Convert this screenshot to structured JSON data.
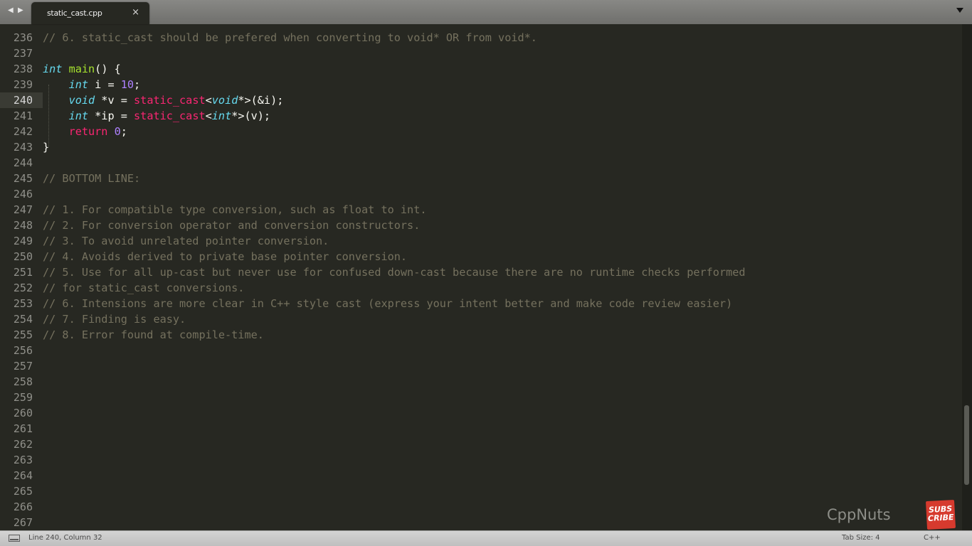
{
  "tab": {
    "nav_prev": "◀",
    "nav_next": "▶",
    "title": "static_cast.cpp",
    "close": "×"
  },
  "lines": [
    {
      "n": "236",
      "text": "// 6. static_cast should be prefered when converting to void* OR from void*."
    },
    {
      "n": "237",
      "text": ""
    },
    {
      "n": "238",
      "text": "int main() {"
    },
    {
      "n": "239",
      "text": "    int i = 10;"
    },
    {
      "n": "240",
      "text": "    void *v = static_cast<void*>(&i);"
    },
    {
      "n": "241",
      "text": "    int *ip = static_cast<int*>(v);"
    },
    {
      "n": "242",
      "text": "    return 0;"
    },
    {
      "n": "243",
      "text": "}"
    },
    {
      "n": "244",
      "text": ""
    },
    {
      "n": "245",
      "text": "// BOTTOM LINE:"
    },
    {
      "n": "246",
      "text": ""
    },
    {
      "n": "247",
      "text": "// 1. For compatible type conversion, such as float to int."
    },
    {
      "n": "248",
      "text": "// 2. For conversion operator and conversion constructors."
    },
    {
      "n": "249",
      "text": "// 3. To avoid unrelated pointer conversion."
    },
    {
      "n": "250",
      "text": "// 4. Avoids derived to private base pointer conversion."
    },
    {
      "n": "251",
      "text": "// 5. Use for all up-cast but never use for confused down-cast because there are no runtime checks performed"
    },
    {
      "n": "252",
      "text": "// for static_cast conversions."
    },
    {
      "n": "253",
      "text": "// 6. Intensions are more clear in C++ style cast (express your intent better and make code review easier)"
    },
    {
      "n": "254",
      "text": "// 7. Finding is easy."
    },
    {
      "n": "255",
      "text": "// 8. Error found at compile-time."
    },
    {
      "n": "256",
      "text": ""
    },
    {
      "n": "257",
      "text": ""
    },
    {
      "n": "258",
      "text": ""
    },
    {
      "n": "259",
      "text": ""
    },
    {
      "n": "260",
      "text": ""
    },
    {
      "n": "261",
      "text": ""
    },
    {
      "n": "262",
      "text": ""
    },
    {
      "n": "263",
      "text": ""
    },
    {
      "n": "264",
      "text": ""
    },
    {
      "n": "265",
      "text": ""
    },
    {
      "n": "266",
      "text": ""
    },
    {
      "n": "267",
      "text": ""
    }
  ],
  "current_line": "240",
  "scrollbar": {
    "position_fraction": 0.8
  },
  "watermark": {
    "brand": "CppNuts",
    "subscribe": "SUBS CRIBE"
  },
  "status": {
    "position": "Line 240, Column 32",
    "tab_size": "Tab Size: 4",
    "syntax": "C++"
  },
  "theme": {
    "background": "#272822",
    "comment": "#75715e",
    "keyword": "#f92672",
    "type": "#66d9ef",
    "function": "#a6e22e",
    "number": "#ae81ff",
    "text": "#f8f8f2"
  }
}
